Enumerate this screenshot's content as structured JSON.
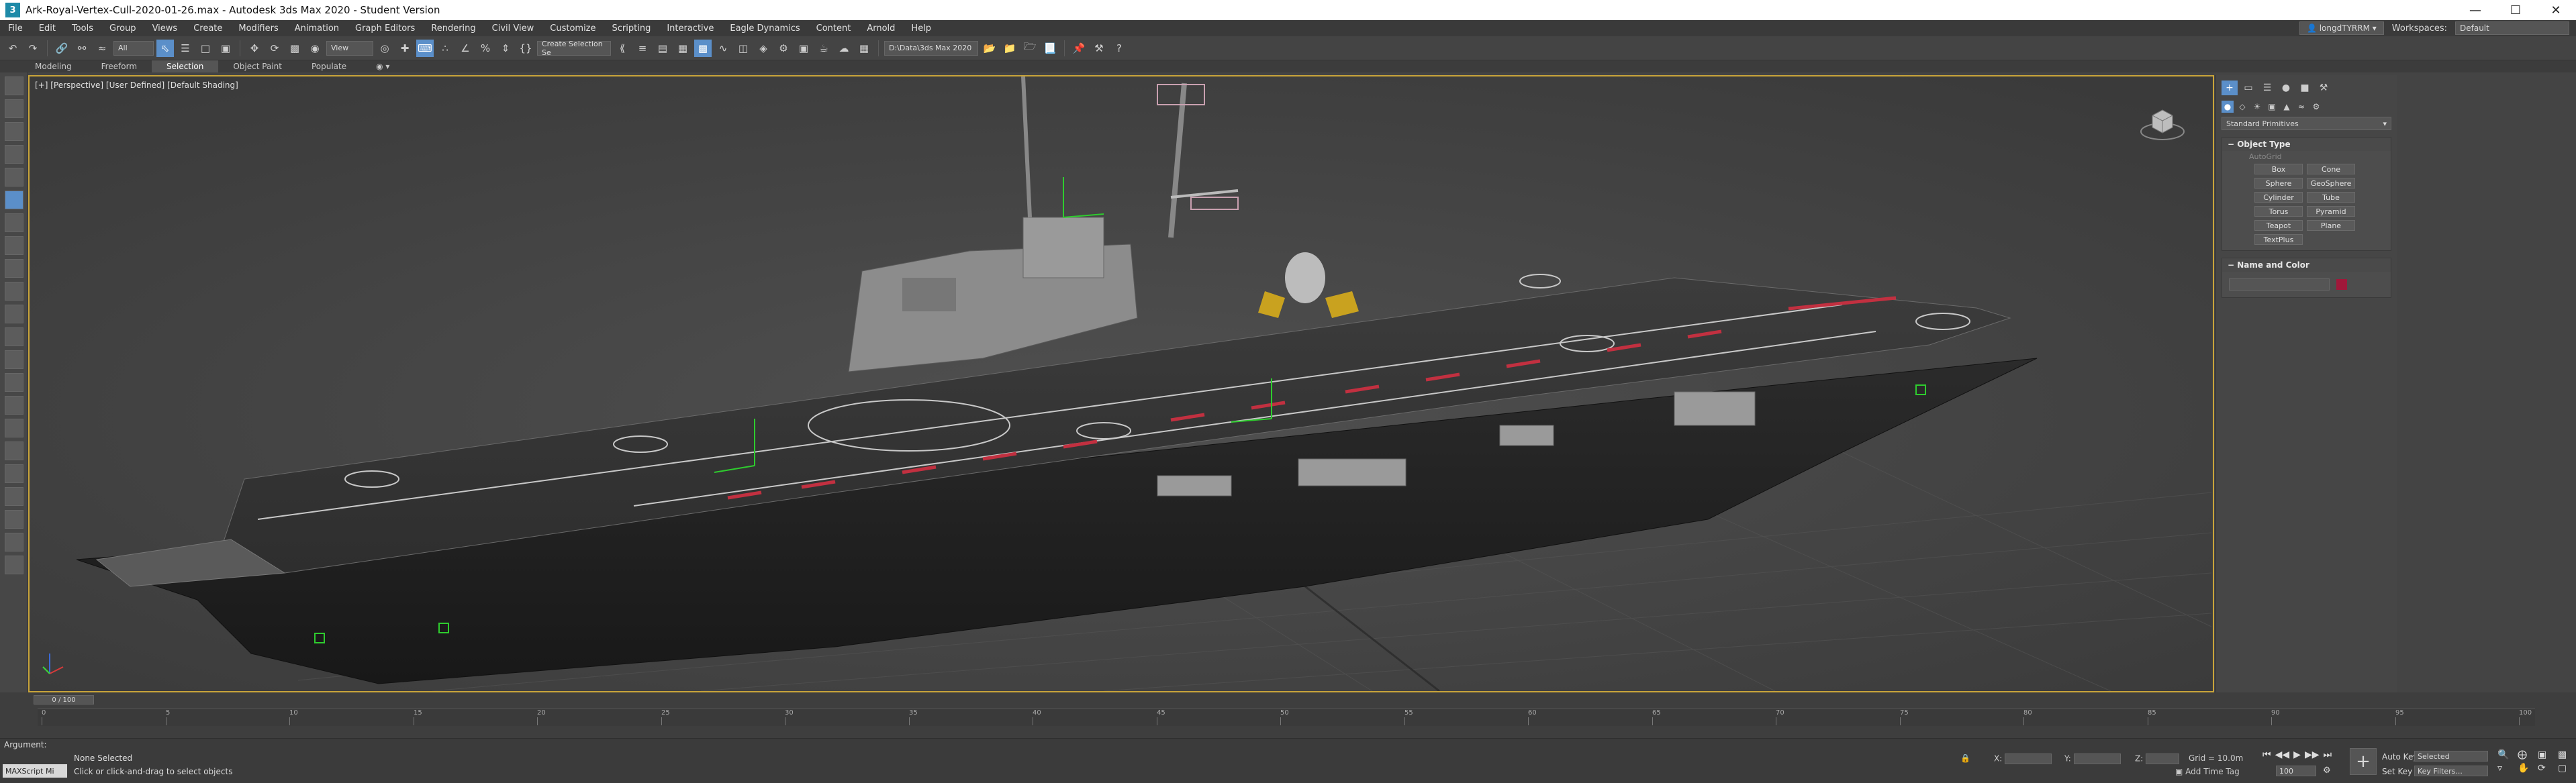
{
  "window": {
    "title": "Ark-Royal-Vertex-Cull-2020-01-26.max - Autodesk 3ds Max 2020 - Student Version",
    "app_icon_letter": "3"
  },
  "menu": [
    "File",
    "Edit",
    "Tools",
    "Group",
    "Views",
    "Create",
    "Modifiers",
    "Animation",
    "Graph Editors",
    "Rendering",
    "Civil View",
    "Customize",
    "Scripting",
    "Interactive",
    "Eagle Dynamics",
    "Content",
    "Arnold",
    "Help"
  ],
  "user": {
    "name": "longdTYRRM",
    "workspace_label": "Workspaces:",
    "workspace_value": "Default"
  },
  "toolbar": {
    "filter_dropdown": "All",
    "view_dropdown": "View",
    "selection_set": "Create Selection Se",
    "project_path": "D:\\Data\\3ds Max 2020"
  },
  "ribbon_tabs": [
    {
      "label": "Modeling",
      "active": false
    },
    {
      "label": "Freeform",
      "active": false
    },
    {
      "label": "Selection",
      "active": true
    },
    {
      "label": "Object Paint",
      "active": false
    },
    {
      "label": "Populate",
      "active": false
    }
  ],
  "viewport": {
    "label": "[+] [Perspective] [User Defined] [Default Shading]"
  },
  "command_panel": {
    "category_dropdown": "Standard Primitives",
    "object_type_title": "Object Type",
    "autogrid": "AutoGrid",
    "primitives": [
      "Box",
      "Cone",
      "Sphere",
      "GeoSphere",
      "Cylinder",
      "Tube",
      "Torus",
      "Pyramid",
      "Teapot",
      "Plane",
      "TextPlus"
    ],
    "name_color_title": "Name and Color",
    "color": "#a0183a"
  },
  "timeline": {
    "slider_text": "0 / 100",
    "ticks": [
      "0",
      "5",
      "10",
      "15",
      "20",
      "25",
      "30",
      "35",
      "40",
      "45",
      "50",
      "55",
      "60",
      "65",
      "70",
      "75",
      "80",
      "85",
      "90",
      "95",
      "100"
    ]
  },
  "status": {
    "argument_label": "Argument:",
    "selection_text": "None Selected",
    "hint_text": "Click or click-and-drag to select objects",
    "maxscript_label": "MAXScript Mi",
    "x_label": "X:",
    "y_label": "Y:",
    "z_label": "Z:",
    "grid_text": "Grid = 10.0m",
    "add_time_tag": "Add Time Tag",
    "auto_key": "Auto Key",
    "set_key": "Set Key",
    "selected_dropdown": "Selected",
    "key_filters": "Key Filters...",
    "frame_value": "100"
  }
}
